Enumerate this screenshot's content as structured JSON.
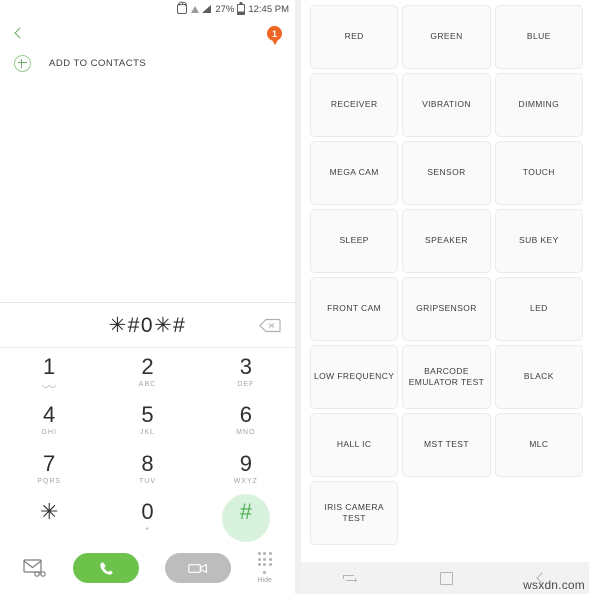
{
  "status_bar": {
    "alarm_icon": "alarm-icon",
    "wifi_icon": "wifi-icon",
    "signal_icon": "signal-icon",
    "battery_percent": "27%",
    "battery_icon": "battery-icon",
    "time": "12:45 PM"
  },
  "app_bar": {
    "back_icon": "back-chevron-icon",
    "notification_count": "1"
  },
  "add_contacts": {
    "icon": "plus-circle-icon",
    "label": "ADD TO CONTACTS"
  },
  "dialer": {
    "number": "✳#0✳#",
    "backspace_icon": "backspace-icon",
    "keys": [
      {
        "digit": "1",
        "sub": "",
        "voicemail": true,
        "pressed": false
      },
      {
        "digit": "2",
        "sub": "ABC",
        "voicemail": false,
        "pressed": false
      },
      {
        "digit": "3",
        "sub": "DEF",
        "voicemail": false,
        "pressed": false
      },
      {
        "digit": "4",
        "sub": "GHI",
        "voicemail": false,
        "pressed": false
      },
      {
        "digit": "5",
        "sub": "JKL",
        "voicemail": false,
        "pressed": false
      },
      {
        "digit": "6",
        "sub": "MNO",
        "voicemail": false,
        "pressed": false
      },
      {
        "digit": "7",
        "sub": "PQRS",
        "voicemail": false,
        "pressed": false
      },
      {
        "digit": "8",
        "sub": "TUV",
        "voicemail": false,
        "pressed": false
      },
      {
        "digit": "9",
        "sub": "WXYZ",
        "voicemail": false,
        "pressed": false
      },
      {
        "digit": "✳",
        "sub": "",
        "voicemail": false,
        "pressed": false
      },
      {
        "digit": "0",
        "sub": "+",
        "voicemail": false,
        "pressed": false
      },
      {
        "digit": "#",
        "sub": "",
        "voicemail": false,
        "pressed": true
      }
    ]
  },
  "action_bar": {
    "message_icon": "message-icon",
    "call_icon": "call-icon",
    "video_call_icon": "video-call-icon",
    "hide_icon": "keypad-dots-icon",
    "hide_label": "Hide"
  },
  "test_menu": {
    "tiles": [
      "RED",
      "GREEN",
      "BLUE",
      "RECEIVER",
      "VIBRATION",
      "DIMMING",
      "MEGA CAM",
      "SENSOR",
      "TOUCH",
      "SLEEP",
      "SPEAKER",
      "SUB KEY",
      "FRONT CAM",
      "GRIPSENSOR",
      "LED",
      "LOW FREQUENCY",
      "BARCODE EMULATOR TEST",
      "BLACK",
      "HALL IC",
      "MST TEST",
      "MLC",
      "IRIS CAMERA TEST"
    ]
  },
  "nav_bar": {
    "recents_icon": "recents-icon",
    "home_icon": "home-icon",
    "back_icon": "back-icon"
  },
  "watermark": {
    "text": "wsxdn.com"
  },
  "colors": {
    "accent_green": "#6cc24a",
    "badge_orange": "#ef6524",
    "key_pressed_bg": "#d9f2dd",
    "video_gray": "#bdbdbd"
  }
}
